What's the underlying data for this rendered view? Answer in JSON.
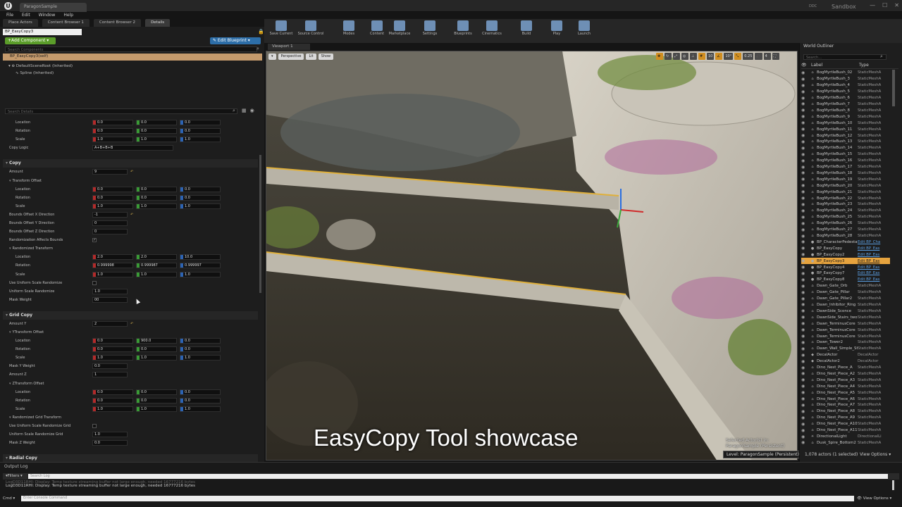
{
  "titlebar": {
    "app_tab": "ParagonSample",
    "sandbox": "Sandbox",
    "badge": "DDC"
  },
  "menu": [
    "File",
    "Edit",
    "Window",
    "Help"
  ],
  "panel_tabs": [
    "Place Actors",
    "Content Browser 1",
    "Content Browser 2",
    "Details"
  ],
  "details": {
    "actor_name": "BP_EasyCopy3",
    "add_component": "+Add Component ▾",
    "edit_blueprint": "✎ Edit Blueprint ▾",
    "component_search_placeholder": "Search Components",
    "self_component": "BP_EasyCopy3(self)",
    "components": [
      "DefaultSceneRoot (Inherited)",
      "Spline (Inherited)"
    ],
    "details_search_placeholder": "Search Details",
    "properties": [
      {
        "kind": "vec",
        "label": "Location",
        "sub": true,
        "v": [
          "0.0",
          "0.0",
          "0.0"
        ]
      },
      {
        "kind": "vec",
        "label": "Rotation",
        "sub": true,
        "v": [
          "0.0",
          "0.0",
          "0.0"
        ]
      },
      {
        "kind": "vec",
        "label": "Scale",
        "sub": true,
        "v": [
          "1.0",
          "1.0",
          "1.0"
        ]
      },
      {
        "kind": "wide",
        "label": "Copy Logic",
        "v": "A+B+B+B"
      },
      {
        "kind": "gap"
      },
      {
        "kind": "cat",
        "label": "Copy"
      },
      {
        "kind": "one",
        "label": "Amount",
        "v": "9",
        "reset": true
      },
      {
        "kind": "group",
        "label": "Transform Offset"
      },
      {
        "kind": "vec",
        "label": "Location",
        "sub": true,
        "v": [
          "0.0",
          "0.0",
          "0.0"
        ]
      },
      {
        "kind": "vec",
        "label": "Rotation",
        "sub": true,
        "v": [
          "0.0",
          "0.0",
          "0.0"
        ]
      },
      {
        "kind": "vec",
        "label": "Scale",
        "sub": true,
        "v": [
          "1.0",
          "1.0",
          "1.0"
        ]
      },
      {
        "kind": "one",
        "label": "Bounds Offset X Direction",
        "v": "-1",
        "reset": true
      },
      {
        "kind": "one",
        "label": "Bounds Offset Y Direction",
        "v": "0"
      },
      {
        "kind": "one",
        "label": "Bounds Offset Z Direction",
        "v": "0"
      },
      {
        "kind": "chk",
        "label": "Randomization Affects Bounds",
        "v": "✓"
      },
      {
        "kind": "group",
        "label": "Randomized Transform"
      },
      {
        "kind": "vec",
        "label": "Location",
        "sub": true,
        "v": [
          "2.0",
          "2.0",
          "10.0"
        ]
      },
      {
        "kind": "vec",
        "label": "Rotation",
        "sub": true,
        "v": [
          "0.999998",
          "0.999987",
          "0.999997"
        ]
      },
      {
        "kind": "vec",
        "label": "Scale",
        "sub": true,
        "v": [
          "1.0",
          "1.0",
          "1.0"
        ]
      },
      {
        "kind": "chk",
        "label": "Use Uniform Scale Randomize",
        "v": ""
      },
      {
        "kind": "one",
        "label": "Uniform Scale Randomize",
        "v": "1.0"
      },
      {
        "kind": "one",
        "label": "Mask Weight",
        "v": "00"
      },
      {
        "kind": "gap"
      },
      {
        "kind": "cat",
        "label": "Grid Copy"
      },
      {
        "kind": "one",
        "label": "Amount Y",
        "v": "2",
        "reset": true
      },
      {
        "kind": "group",
        "label": "YTransform Offset"
      },
      {
        "kind": "vec",
        "label": "Location",
        "sub": true,
        "v": [
          "0.0",
          "900.0",
          "0.0"
        ]
      },
      {
        "kind": "vec",
        "label": "Rotation",
        "sub": true,
        "v": [
          "0.0",
          "0.0",
          "0.0"
        ]
      },
      {
        "kind": "vec",
        "label": "Scale",
        "sub": true,
        "v": [
          "1.0",
          "1.0",
          "1.0"
        ]
      },
      {
        "kind": "one",
        "label": "Mask Y Weight",
        "v": "0.0"
      },
      {
        "kind": "one",
        "label": "Amount Z",
        "v": "1"
      },
      {
        "kind": "group",
        "label": "ZTransform Offset"
      },
      {
        "kind": "vec",
        "label": "Location",
        "sub": true,
        "v": [
          "0.0",
          "0.0",
          "0.0"
        ]
      },
      {
        "kind": "vec",
        "label": "Rotation",
        "sub": true,
        "v": [
          "0.0",
          "0.0",
          "0.0"
        ]
      },
      {
        "kind": "vec",
        "label": "Scale",
        "sub": true,
        "v": [
          "1.0",
          "1.0",
          "1.0"
        ]
      },
      {
        "kind": "group",
        "label": "Randomized Grid Transform"
      },
      {
        "kind": "chk",
        "label": "Use Uniform Scale Randomize Grid",
        "v": ""
      },
      {
        "kind": "one",
        "label": "Uniform Scale Randomize Grid",
        "v": "1.0"
      },
      {
        "kind": "one",
        "label": "Mask Z Weight",
        "v": "0.0"
      },
      {
        "kind": "gap"
      },
      {
        "kind": "cat",
        "label": "Radial Copy"
      }
    ]
  },
  "toolbar": [
    "Save Current",
    "Source Control",
    "Modes",
    "Content",
    "Marketplace",
    "Settings",
    "Blueprints",
    "Cinematics",
    "Build",
    "Play",
    "Launch"
  ],
  "viewport": {
    "tab": "Viewport 1",
    "buttons": [
      "▾",
      "Perspective",
      "Lit",
      "Show"
    ],
    "right_icons": [
      "10",
      "10°",
      "0.25",
      "4"
    ],
    "caption": "EasyCopy Tool showcase",
    "selected_line1": "Selected Actor(s) in:",
    "selected_line2": "ParagonSample (Persistent)",
    "level": "Level: ParagonSample (Persistent)"
  },
  "outliner": {
    "tab": "World Outliner",
    "search_placeholder": "Search...",
    "col_label": "Label",
    "col_type": "Type",
    "footer": "1,078 actors (1 selected)",
    "view_options": "View Options ▾",
    "rows": [
      {
        "l": "BogMyrtleBush_02",
        "t": "StaticMeshA"
      },
      {
        "l": "BogMyrtleBush_3",
        "t": "StaticMeshA"
      },
      {
        "l": "BogMyrtleBush_4",
        "t": "StaticMeshA"
      },
      {
        "l": "BogMyrtleBush_5",
        "t": "StaticMeshA"
      },
      {
        "l": "BogMyrtleBush_6",
        "t": "StaticMeshA"
      },
      {
        "l": "BogMyrtleBush_7",
        "t": "StaticMeshA"
      },
      {
        "l": "BogMyrtleBush_8",
        "t": "StaticMeshA"
      },
      {
        "l": "BogMyrtleBush_9",
        "t": "StaticMeshA"
      },
      {
        "l": "BogMyrtleBush_10",
        "t": "StaticMeshA"
      },
      {
        "l": "BogMyrtleBush_11",
        "t": "StaticMeshA"
      },
      {
        "l": "BogMyrtleBush_12",
        "t": "StaticMeshA"
      },
      {
        "l": "BogMyrtleBush_13",
        "t": "StaticMeshA"
      },
      {
        "l": "BogMyrtleBush_14",
        "t": "StaticMeshA"
      },
      {
        "l": "BogMyrtleBush_15",
        "t": "StaticMeshA"
      },
      {
        "l": "BogMyrtleBush_16",
        "t": "StaticMeshA"
      },
      {
        "l": "BogMyrtleBush_17",
        "t": "StaticMeshA"
      },
      {
        "l": "BogMyrtleBush_18",
        "t": "StaticMeshA"
      },
      {
        "l": "BogMyrtleBush_19",
        "t": "StaticMeshA"
      },
      {
        "l": "BogMyrtleBush_20",
        "t": "StaticMeshA"
      },
      {
        "l": "BogMyrtleBush_21",
        "t": "StaticMeshA"
      },
      {
        "l": "BogMyrtleBush_22",
        "t": "StaticMeshA"
      },
      {
        "l": "BogMyrtleBush_23",
        "t": "StaticMeshA"
      },
      {
        "l": "BogMyrtleBush_24",
        "t": "StaticMeshA"
      },
      {
        "l": "BogMyrtleBush_25",
        "t": "StaticMeshA"
      },
      {
        "l": "BogMyrtleBush_26",
        "t": "StaticMeshA"
      },
      {
        "l": "BogMyrtleBush_27",
        "t": "StaticMeshA"
      },
      {
        "l": "BogMyrtleBush_28",
        "t": "StaticMeshA"
      },
      {
        "l": "BP_CharacterPedestal",
        "t": "Edit BP_Cha",
        "link": true
      },
      {
        "l": "BP_EasyCopy",
        "t": "Edit BP_Eas",
        "link": true
      },
      {
        "l": "BP_EasyCopy2",
        "t": "Edit BP_Eas",
        "link": true
      },
      {
        "l": "BP_EasyCopy3",
        "t": "Edit BP_Eas",
        "link": true,
        "sel": true
      },
      {
        "l": "BP_EasyCopy4",
        "t": "Edit BP_Eas",
        "link": true
      },
      {
        "l": "BP_EasyCopy7",
        "t": "Edit BP_Eas",
        "link": true
      },
      {
        "l": "BP_EasyCopy8",
        "t": "Edit BP_Eas",
        "link": true
      },
      {
        "l": "Dawn_Gate_Orb",
        "t": "StaticMeshA"
      },
      {
        "l": "Dawn_Gate_Pillar",
        "t": "StaticMeshA"
      },
      {
        "l": "Dawn_Gate_Pillar2",
        "t": "StaticMeshA"
      },
      {
        "l": "Dawn_Inhibitor_Ring",
        "t": "StaticMeshA"
      },
      {
        "l": "DawnSide_Sconce",
        "t": "StaticMeshA"
      },
      {
        "l": "DawnSide_Stairs_two",
        "t": "StaticMeshA"
      },
      {
        "l": "Dawn_TerminusCore",
        "t": "StaticMeshA"
      },
      {
        "l": "Dawn_TerminusCore",
        "t": "StaticMeshA"
      },
      {
        "l": "Dawn_TerminusCore",
        "t": "StaticMeshA"
      },
      {
        "l": "Dawn_Tower2",
        "t": "StaticMeshA"
      },
      {
        "l": "Dawn_Wall_Simple_St",
        "t": "StaticMeshA"
      },
      {
        "l": "DecalActor",
        "t": "DecalActor"
      },
      {
        "l": "DecalActor2",
        "t": "DecalActor"
      },
      {
        "l": "Dino_Nest_Piece_A",
        "t": "StaticMeshA"
      },
      {
        "l": "Dino_Nest_Piece_A2",
        "t": "StaticMeshA"
      },
      {
        "l": "Dino_Nest_Piece_A3",
        "t": "StaticMeshA"
      },
      {
        "l": "Dino_Nest_Piece_A4",
        "t": "StaticMeshA"
      },
      {
        "l": "Dino_Nest_Piece_A5",
        "t": "StaticMeshA"
      },
      {
        "l": "Dino_Nest_Piece_A6",
        "t": "StaticMeshA"
      },
      {
        "l": "Dino_Nest_Piece_A7",
        "t": "StaticMeshA"
      },
      {
        "l": "Dino_Nest_Piece_A8",
        "t": "StaticMeshA"
      },
      {
        "l": "Dino_Nest_Piece_A9",
        "t": "StaticMeshA"
      },
      {
        "l": "Dino_Nest_Piece_A10",
        "t": "StaticMeshA"
      },
      {
        "l": "Dino_Nest_Piece_A11",
        "t": "StaticMeshA"
      },
      {
        "l": "DirectionalLight",
        "t": "DirectionalLi"
      },
      {
        "l": "Dusk_Spire_Bottom2",
        "t": "StaticMeshA"
      }
    ]
  },
  "log": {
    "tab": "Output Log",
    "filters": "▾Filters ▾",
    "search_placeholder": "Search Log",
    "line_faded": "LogD3D11RHI: Display: Temp texture streaming buffer not large enough, needed 16777216 bytes",
    "line": "LogD3D11RHI: Display: Temp texture streaming buffer not large enough, needed 16777216 bytes",
    "cmd": "Cmd ▾",
    "cmd_placeholder": "Enter Console Command",
    "view_options": "👁 View Options ▾"
  },
  "colors": {
    "x": "#b32a2a",
    "y": "#3a9a36",
    "z": "#2c63b3",
    "selected_row": "#e6a33e",
    "add_button": "#5b9d2a",
    "blueprint_button": "#2d6ea8"
  }
}
